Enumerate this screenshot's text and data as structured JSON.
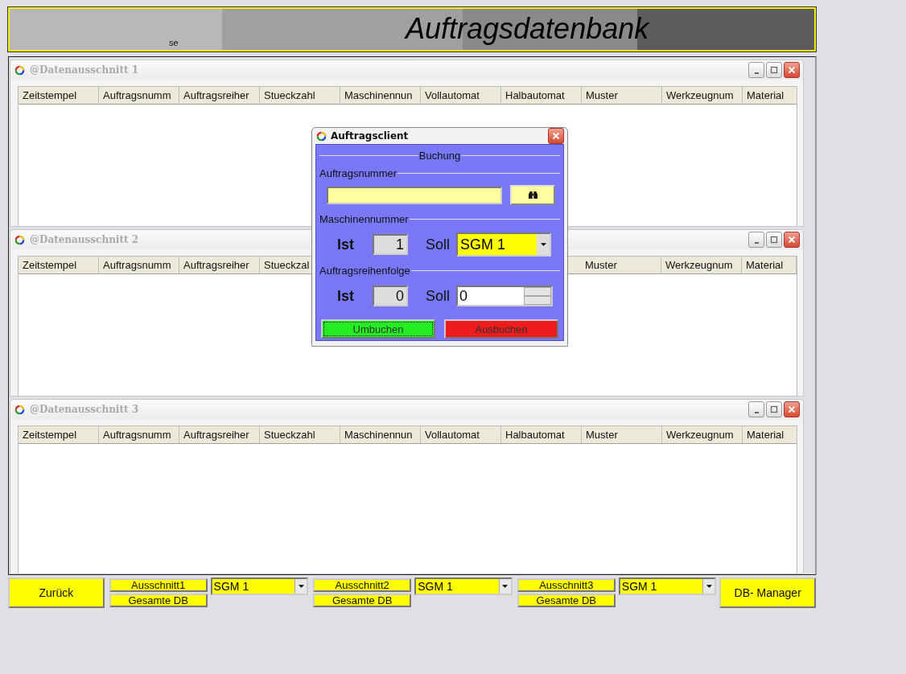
{
  "banner": {
    "title": "Auftragsdatenbank",
    "subtitle": "se"
  },
  "windows": [
    {
      "title": "@Datenausschnitt 1",
      "columns": [
        {
          "label": "Zeitstempel"
        },
        {
          "label": "Auftragsnumm"
        },
        {
          "label": "Auftragsreiher"
        },
        {
          "label": "Stueckzahl"
        },
        {
          "label": "Maschinennun"
        },
        {
          "label": "Vollautomat"
        },
        {
          "label": "Halbautomat"
        },
        {
          "label": "Muster"
        },
        {
          "label": "Werkzeugnum"
        },
        {
          "label": "Material"
        }
      ]
    },
    {
      "title": "@Datenausschnitt 2",
      "columns": [
        {
          "label": "Zeitstempel"
        },
        {
          "label": "Auftragsnumm"
        },
        {
          "label": "Auftragsreiher"
        },
        {
          "label": "Stueckzal"
        }
      ],
      "columns_right": [
        {
          "label": "Muster"
        },
        {
          "label": "Werkzeugnum"
        },
        {
          "label": "Material"
        }
      ]
    },
    {
      "title": "@Datenausschnitt 3",
      "columns": [
        {
          "label": "Zeitstempel"
        },
        {
          "label": "Auftragsnumm"
        },
        {
          "label": "Auftragsreiher"
        },
        {
          "label": "Stueckzahl"
        },
        {
          "label": "Maschinennun"
        },
        {
          "label": "Vollautomat"
        },
        {
          "label": "Halbautomat"
        },
        {
          "label": "Muster"
        },
        {
          "label": "Werkzeugnum"
        },
        {
          "label": "Material"
        }
      ]
    }
  ],
  "dialog": {
    "title": "Auftragsclient",
    "group": "Buchung",
    "order": {
      "legend": "Auftragsnummer"
    },
    "machine": {
      "legend": "Maschinennummer",
      "ist_label": "Ist",
      "ist_value": "1",
      "soll_label": "Soll",
      "soll_value": "SGM 1"
    },
    "sequence": {
      "legend": "Auftragsreihenfolge",
      "ist_label": "Ist",
      "ist_value": "0",
      "soll_label": "Soll",
      "soll_value": "0"
    },
    "buttons": [
      {
        "label": "Umbuchen",
        "kind": "confirm",
        "focused": true
      },
      {
        "label": "Ausbuchen",
        "kind": "cancel",
        "focused": false
      }
    ]
  },
  "footer": {
    "back": "Zurück",
    "groups": [
      {
        "section": "Ausschnitt1",
        "all": "Gesamte DB",
        "combo": "SGM 1"
      },
      {
        "section": "Ausschnitt2",
        "all": "Gesamte DB",
        "combo": "SGM 1"
      },
      {
        "section": "Ausschnitt3",
        "all": "Gesamte DB",
        "combo": "SGM 1"
      }
    ],
    "manager": "DB- Manager"
  }
}
